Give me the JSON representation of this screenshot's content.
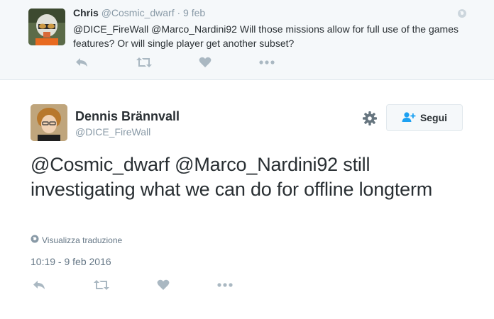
{
  "reply_tweet": {
    "name": "Chris",
    "handle": "@Cosmic_dwarf",
    "separator": "·",
    "time": "9 feb",
    "text": "@DICE_FireWall @Marco_Nardini92 Will those missions allow for full use of the games features? Or will single player get another subset?",
    "actions": [
      "reply-icon",
      "retweet-icon",
      "like-icon",
      "more-icon"
    ]
  },
  "main_tweet": {
    "fullname": "Dennis Brännvall",
    "username": "@DICE_FireWall",
    "follow_label": "Segui",
    "text": "@Cosmic_dwarf @Marco_Nardini92 still investigating what we can do for offline longterm",
    "translate_label": "Visualizza traduzione",
    "timestamp": "10:19 - 9 feb 2016",
    "actions": [
      "reply-icon",
      "retweet-icon",
      "like-icon",
      "more-icon"
    ]
  },
  "colors": {
    "text": "#292f33",
    "muted": "#8899a6",
    "icon": "#aab8c2",
    "link_blue": "#1da1f2",
    "reply_bg": "#f5f8fa"
  }
}
